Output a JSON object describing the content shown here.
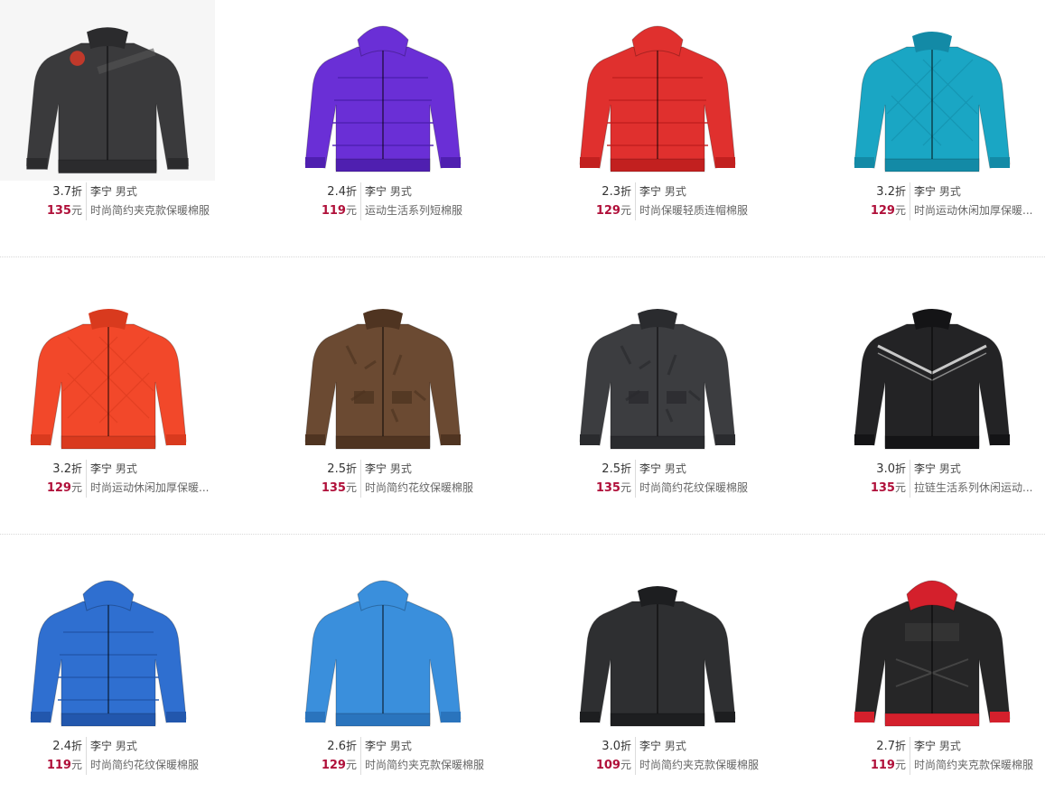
{
  "currency_unit": "元",
  "discount_unit": "折",
  "products": [
    {
      "discount": "3.7",
      "brand": "李宁",
      "gender": "男式",
      "price": "135",
      "name": "时尚简约夹克款保暖棉服",
      "color": "#3a3a3c",
      "accent": "#2b2b2d",
      "style": "logo-patch",
      "hood": false
    },
    {
      "discount": "2.4",
      "brand": "李宁",
      "gender": "男式",
      "price": "119",
      "name": "运动生活系列短棉服",
      "color": "#6a2fd6",
      "accent": "#4f1fb0",
      "style": "puffer",
      "hood": true
    },
    {
      "discount": "2.3",
      "brand": "李宁",
      "gender": "男式",
      "price": "129",
      "name": "时尚保暖轻质连帽棉服",
      "color": "#e0302e",
      "accent": "#c2201f",
      "style": "puffer",
      "hood": true
    },
    {
      "discount": "3.2",
      "brand": "李宁",
      "gender": "男式",
      "price": "129",
      "name": "时尚运动休闲加厚保暖...",
      "color": "#1aa6c4",
      "accent": "#138aa6",
      "style": "quilted",
      "hood": false
    },
    {
      "discount": "3.2",
      "brand": "李宁",
      "gender": "男式",
      "price": "129",
      "name": "时尚运动休闲加厚保暖...",
      "color": "#f2482a",
      "accent": "#d93a1e",
      "style": "quilted",
      "hood": false
    },
    {
      "discount": "2.5",
      "brand": "李宁",
      "gender": "男式",
      "price": "135",
      "name": "时尚简约花纹保暖棉服",
      "color": "#6b4a32",
      "accent": "#4f3421",
      "style": "pattern",
      "hood": false
    },
    {
      "discount": "2.5",
      "brand": "李宁",
      "gender": "男式",
      "price": "135",
      "name": "时尚简约花纹保暖棉服",
      "color": "#3c3d40",
      "accent": "#2a2b2e",
      "style": "pattern",
      "hood": false
    },
    {
      "discount": "3.0",
      "brand": "李宁",
      "gender": "男式",
      "price": "135",
      "name": "拉链生活系列休闲运动...",
      "color": "#232325",
      "accent": "#141416",
      "style": "chevron",
      "hood": false
    },
    {
      "discount": "2.4",
      "brand": "李宁",
      "gender": "男式",
      "price": "119",
      "name": "时尚简约花纹保暖棉服",
      "color": "#2f6fd0",
      "accent": "#2257ad",
      "style": "puffer",
      "hood": true
    },
    {
      "discount": "2.6",
      "brand": "李宁",
      "gender": "男式",
      "price": "129",
      "name": "时尚简约夹克款保暖棉服",
      "color": "#3a8fdc",
      "accent": "#2a74bd",
      "style": "plain",
      "hood": true
    },
    {
      "discount": "3.0",
      "brand": "李宁",
      "gender": "男式",
      "price": "109",
      "name": "时尚简约夹克款保暖棉服",
      "color": "#2e2f31",
      "accent": "#1d1e20",
      "style": "plain",
      "hood": false
    },
    {
      "discount": "2.7",
      "brand": "李宁",
      "gender": "男式",
      "price": "119",
      "name": "时尚简约夹克款保暖棉服",
      "color": "#262627",
      "accent": "#d4202c",
      "style": "hood-red",
      "hood": true
    }
  ]
}
